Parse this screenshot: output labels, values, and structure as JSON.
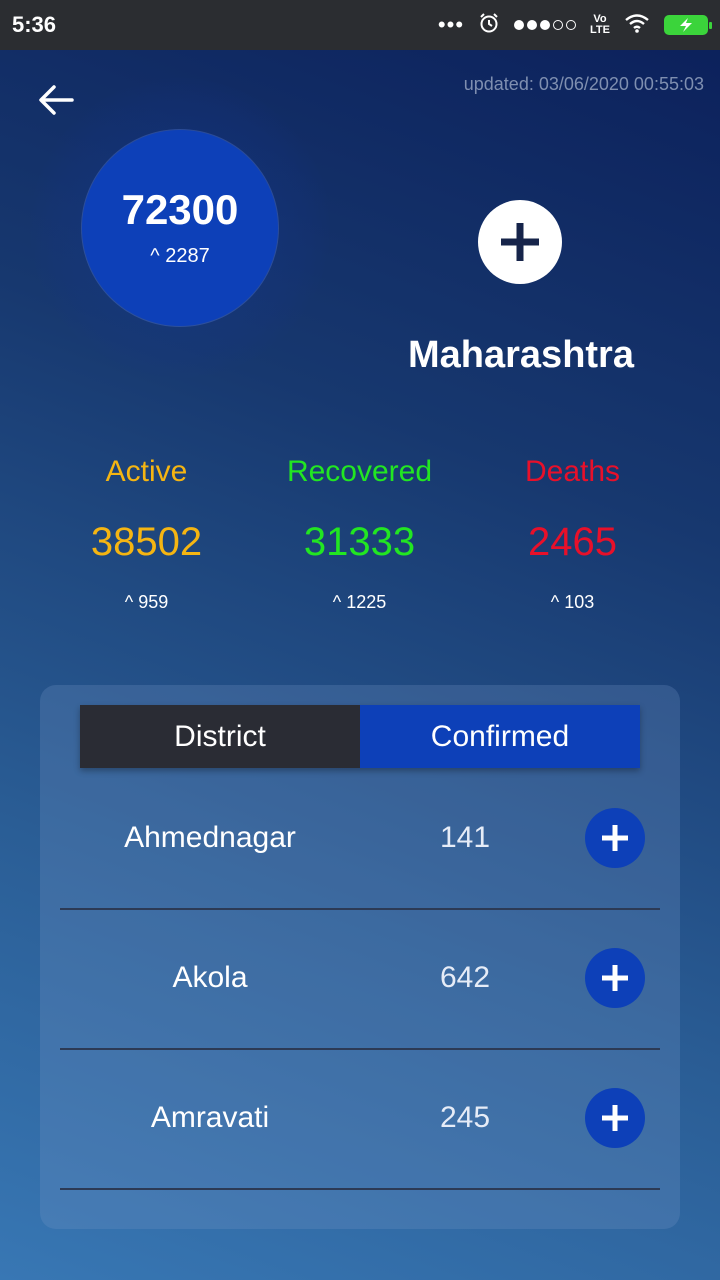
{
  "status_bar": {
    "time": "5:36",
    "dots": "•••",
    "volte_top": "Vo",
    "volte_bottom": "LTE"
  },
  "header": {
    "updated": "updated: 03/06/2020 00:55:03"
  },
  "summary": {
    "total": "72300",
    "total_delta": "^ 2287",
    "state": "Maharashtra"
  },
  "stats": [
    {
      "label": "Active",
      "value": "38502",
      "delta": "^ 959",
      "color": "#f5b512"
    },
    {
      "label": "Recovered",
      "value": "31333",
      "delta": "^ 1225",
      "color": "#22e622"
    },
    {
      "label": "Deaths",
      "value": "2465",
      "delta": "^ 103",
      "color": "#e8102a"
    }
  ],
  "table": {
    "col_district": "District",
    "col_confirmed": "Confirmed",
    "rows": [
      {
        "district": "Ahmednagar",
        "confirmed": "141"
      },
      {
        "district": "Akola",
        "confirmed": "642"
      },
      {
        "district": "Amravati",
        "confirmed": "245"
      }
    ]
  },
  "colors": {
    "accent_blue": "#0d40b8",
    "header_dark": "#2a2c34",
    "battery_green": "#3bd43b"
  }
}
